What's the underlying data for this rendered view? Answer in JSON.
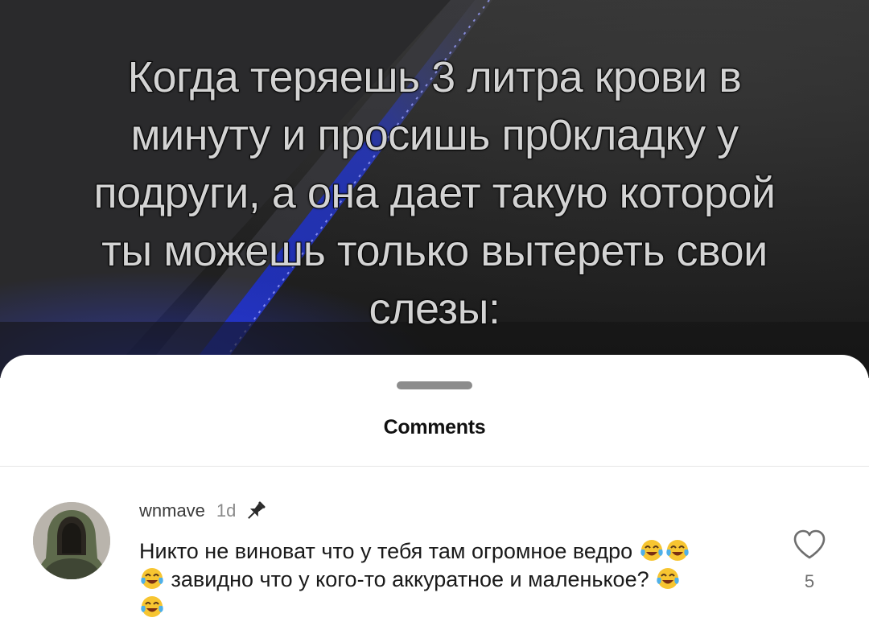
{
  "video": {
    "caption_lines": [
      "Когда теряешь 3 литра крови в",
      "минуту и просишь пр0кладку у",
      "подруги, а она дает такую которой",
      "ты можешь только вытереть свои",
      "слезы:"
    ]
  },
  "sheet": {
    "title": "Comments"
  },
  "comment": {
    "username": "wnmave",
    "time": "1d",
    "text_part1": "Никто не виноват что у тебя там огромное ведро",
    "text_part2": "завидно что у кого-то аккуратное и маленькое?",
    "like_count": "5",
    "emoji": "tears-of-joy-emoji",
    "icons": {
      "pin": "pin-icon",
      "like": "heart-outline-icon"
    }
  },
  "colors": {
    "caption_text": "#d3d3d3",
    "blue_light": "#2b3fd8",
    "sheet_bg": "#ffffff",
    "grabber": "#8c8c8c"
  }
}
